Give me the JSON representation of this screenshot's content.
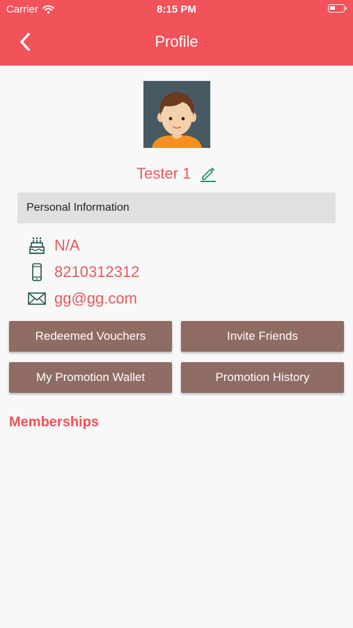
{
  "status_bar": {
    "carrier": "Carrier",
    "time": "8:15 PM",
    "battery_level": 0.4
  },
  "header": {
    "title": "Profile",
    "back_icon": "chevron-left-icon"
  },
  "profile": {
    "name": "Tester 1",
    "edit_icon": "pencil-icon"
  },
  "personal_info": {
    "heading": "Personal Information",
    "birthday": "N/A",
    "phone": "8210312312",
    "email": "gg@gg.com"
  },
  "actions": {
    "redeemed_vouchers": "Redeemed Vouchers",
    "invite_friends": "Invite Friends",
    "promotion_wallet": "My Promotion Wallet",
    "promotion_history": "Promotion History"
  },
  "memberships": {
    "heading": "Memberships"
  },
  "colors": {
    "accent": "#f2525a",
    "button": "#8e6b63",
    "text_accent": "#e55a5f",
    "icon": "#1f5449"
  }
}
